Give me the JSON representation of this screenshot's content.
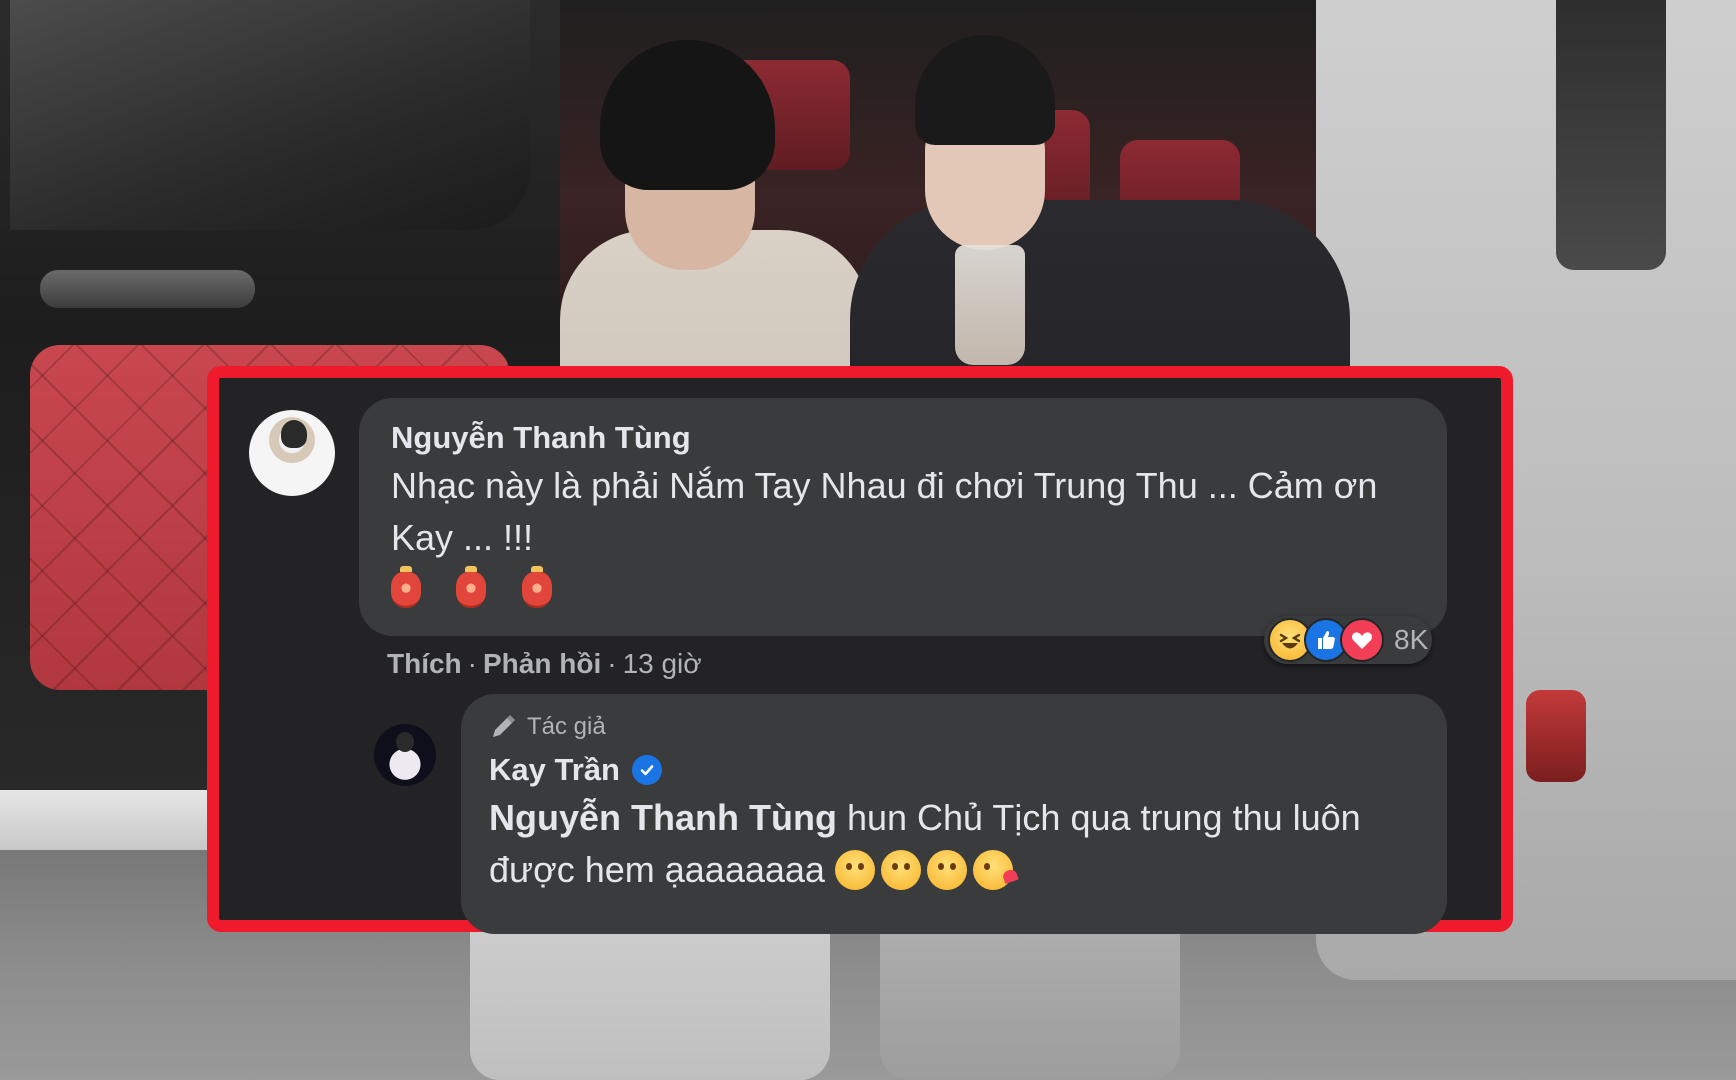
{
  "comment": {
    "author": "Nguyễn Thanh Tùng",
    "text": "Nhạc này là phải Nắm Tay Nhau đi chơi Trung Thu ... Cảm ơn Kay ... !!!",
    "lantern_emojis": [
      "lantern-icon",
      "lantern-icon",
      "lantern-icon"
    ],
    "actions": {
      "like": "Thích",
      "separator": "·",
      "reply": "Phản hồi",
      "time": "13 giờ"
    },
    "reactions": {
      "types": [
        "haha",
        "like",
        "love"
      ],
      "count": "8K"
    }
  },
  "reply": {
    "author_badge": "Tác giả",
    "author": "Kay Trần",
    "verified": true,
    "mention": "Nguyễn Thanh Tùng",
    "text": " hun Chủ Tịch qua trung thu luôn được hem ạaaaaaaa",
    "emojis": [
      "face-with-open-mouth-icon",
      "smiling-face-icon",
      "smiling-face-icon",
      "kissing-heart-icon"
    ]
  },
  "colors": {
    "frame_border": "#ef1b2d",
    "bubble_bg": "#3a3b3c",
    "text": "#e4e6eb",
    "secondary_text": "#b0b3b8",
    "facebook_blue": "#1b74e4",
    "love_red": "#f33e58"
  }
}
